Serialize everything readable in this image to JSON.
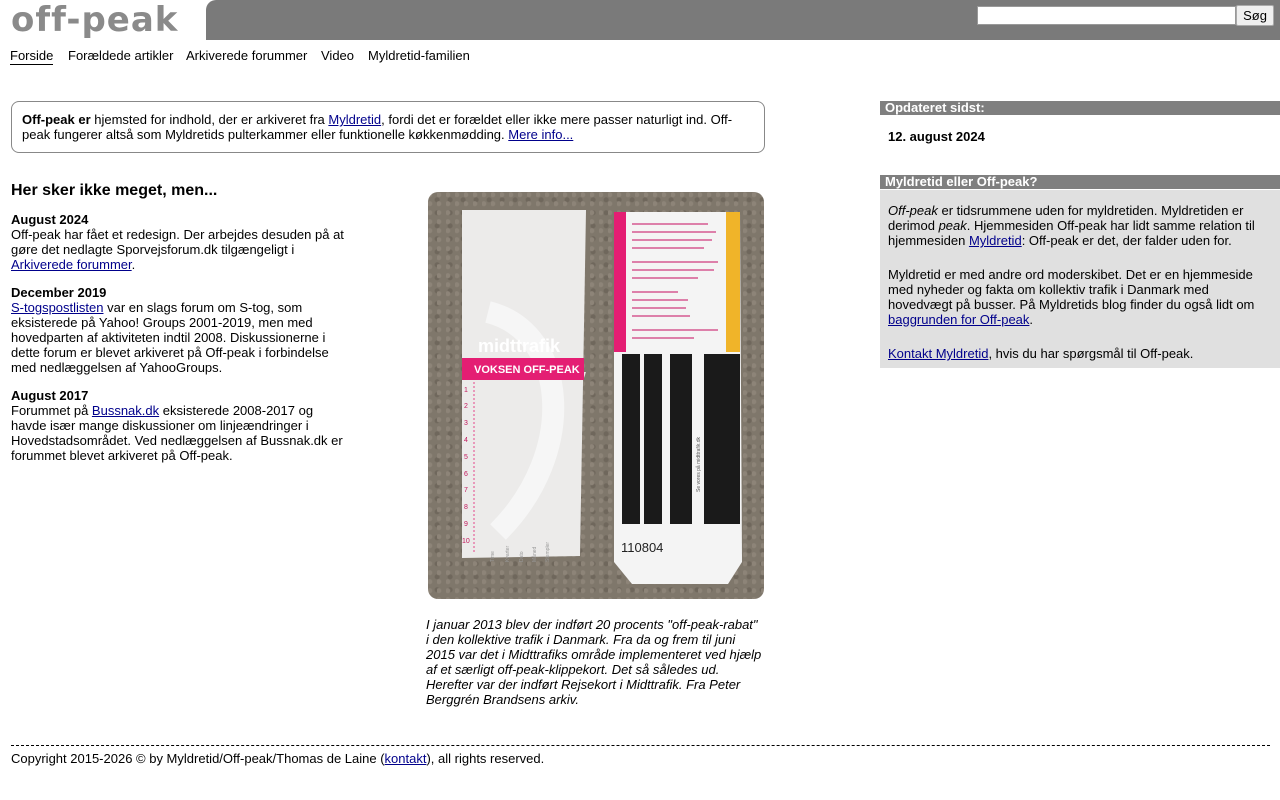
{
  "logo": {
    "text": "off-peak"
  },
  "search": {
    "value": "",
    "placeholder": "",
    "button_label": "Søg"
  },
  "nav": [
    {
      "label": "Forside",
      "active": true
    },
    {
      "label": "Forældede artikler"
    },
    {
      "label": "Arkiverede forummer"
    },
    {
      "label": "Video"
    },
    {
      "label": "Myldretid-familien"
    }
  ],
  "intro": {
    "bold": "Off-peak er",
    "text1": " hjemsted for indhold, der er arkiveret fra ",
    "link1": "Myldretid",
    "text2": ", fordi det er forældet eller ikke mere passer naturligt ind. Off-peak fungerer altså som Myldretids pulterkammer eller funktionelle køkkenmødding. ",
    "link2": "Mere info..."
  },
  "news": {
    "heading": "Her sker ikke meget, men...",
    "items": [
      {
        "date": "August 2024",
        "text1": "Off-peak har fået et redesign. Der arbejdes desuden på at gøre det nedlagte Sporvejsforum.dk tilgængeligt i ",
        "link": "Arkiverede forummer",
        "text2": "."
      },
      {
        "date": "December 2019",
        "text1": "",
        "link": "S-togspostlisten",
        "text2": " var en slags forum om S-tog, som eksisterede på Yahoo! Groups 2001-2019, men med hovedparten af aktiviteten indtil 2008. Diskussionerne i dette forum er blevet arkiveret på Off-peak i forbindelse med nedlæggelsen af YahooGroups."
      },
      {
        "date": "August 2017",
        "text1": "Forummet på ",
        "link": "Bussnak.dk",
        "text2": " eksisterede 2008-2017 og havde især mange diskussioner om linjeændringer i Hovedstadsområdet. Ved nedlæggelsen af Bussnak.dk er forummet blevet arkiveret på Off-peak."
      }
    ]
  },
  "photo": {
    "left_card": {
      "brand": "midttrafik",
      "label": "VOKSEN OFF-PEAK",
      "numbers": [
        "1",
        "2",
        "3",
        "4",
        "5",
        "6",
        "7",
        "8",
        "9",
        "10"
      ],
      "columns": [
        "Time",
        "Kvarter",
        "Dato",
        "Måned",
        "Stempler"
      ]
    },
    "right_card": {
      "number": "110804",
      "side_text": "Se vores på midttrafik.dk"
    },
    "caption": "I januar 2013 blev der indført 20 procents \"off-peak-rabat\" i den kollektive trafik i Danmark. Fra da og frem til juni 2015 var det i Midttrafiks område implementeret ved hjælp af et særligt off-peak-klippekort. Det så således ud. Herefter var der indført Rejsekort i Midttrafik. Fra Peter Berggrén Brandsens arkiv."
  },
  "sidebar": {
    "updated_title": "Opdateret sidst:",
    "updated_date": "12. august 2024",
    "compare_title": "Myldretid eller Off-peak?",
    "p1": {
      "em1": "Off-peak",
      "t1": " er tidsrummene uden for myldretiden. Myldretiden er derimod ",
      "em2": "peak",
      "t2": ". Hjemmesiden Off-peak har lidt samme relation til hjemmesiden ",
      "link": "Myldretid",
      "t3": ": Off-peak er det, der falder uden for."
    },
    "p2": {
      "t1": "Myldretid er med andre ord moderskibet. Det er en hjemmeside med nyheder og fakta om kollektiv trafik i Danmark med hovedvægt på busser. På Myldretids blog finder du også lidt om ",
      "link": "baggrunden for Off-peak",
      "t2": "."
    },
    "p3": {
      "link": "Kontakt Myldretid",
      "t1": ", hvis du har spørgsmål til Off-peak."
    }
  },
  "footer": {
    "t1": "Copyright 2015-2026 © by Myldretid/Off-peak/Thomas de Laine (",
    "link": "kontakt",
    "t2": "), all rights reserved."
  },
  "colors": {
    "header_bar": "#7a7a7a",
    "sidebar_bg": "#e0e0e0",
    "sidebar_head": "#7f7f7f",
    "logo": "#8a8a8a",
    "card_stripe": "#f0b429",
    "card_pink": "#e0206f"
  }
}
